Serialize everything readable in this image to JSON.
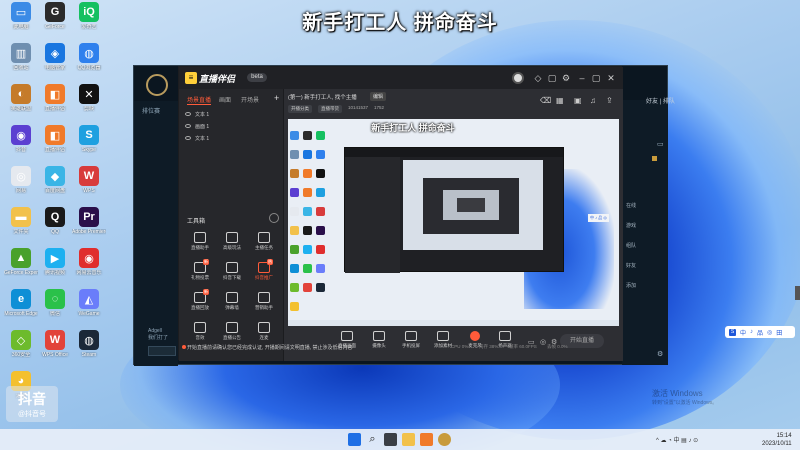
{
  "caption": "新手打工人 拼命奋斗",
  "desktop_icons": [
    {
      "label": "此电脑",
      "color": "#3b8be6",
      "glyph": "▭"
    },
    {
      "label": "GeForce",
      "color": "#2b2b2b",
      "glyph": "G"
    },
    {
      "label": "爱奇艺",
      "color": "#15c060",
      "glyph": "iQ"
    },
    {
      "label": "回收站",
      "color": "#6f8fb0",
      "glyph": "▥"
    },
    {
      "label": "电脑管家",
      "color": "#1976e0",
      "glyph": "◈"
    },
    {
      "label": "QQ浏览器",
      "color": "#2f80ed",
      "glyph": "◍"
    },
    {
      "label": "英雄联盟",
      "color": "#c57b2a",
      "glyph": "◐"
    },
    {
      "label": "直播伴侣",
      "color": "#f07a2a",
      "glyph": "◧"
    },
    {
      "label": "剪映",
      "color": "#111111",
      "glyph": "✕"
    },
    {
      "label": "抖音",
      "color": "#5b3fd1",
      "glyph": "◉"
    },
    {
      "label": "直播伴侣",
      "color": "#f07a2a",
      "glyph": "◧"
    },
    {
      "label": "Skype",
      "color": "#1ea0e0",
      "glyph": "S"
    },
    {
      "label": "网易",
      "color": "#e5e9ef",
      "glyph": "◎"
    },
    {
      "label": "百度网盘",
      "color": "#3ab5e6",
      "glyph": "◆"
    },
    {
      "label": "WPS",
      "color": "#d83b3b",
      "glyph": "W"
    },
    {
      "label": "文件夹",
      "color": "#f2c14b",
      "glyph": "▬"
    },
    {
      "label": "QQ",
      "color": "#1a1a1a",
      "glyph": "Q"
    },
    {
      "label": "Adobe Premiere",
      "color": "#2a0f4a",
      "glyph": "Pr"
    },
    {
      "label": "GeForce Experience",
      "color": "#49a12b",
      "glyph": "▲"
    },
    {
      "label": "腾讯视频",
      "color": "#1db0f0",
      "glyph": "▶"
    },
    {
      "label": "网易云音乐",
      "color": "#e02d2d",
      "glyph": "◉"
    },
    {
      "label": "Microsoft Edge",
      "color": "#0e8fd6",
      "glyph": "e"
    },
    {
      "label": "微信",
      "color": "#2ac14a",
      "glyph": "◌"
    },
    {
      "label": "WeGame",
      "color": "#6a7dfa",
      "glyph": "◭"
    },
    {
      "label": "360安全",
      "color": "#6dbb2c",
      "glyph": "◇"
    },
    {
      "label": "WPS Office",
      "color": "#e2433a",
      "glyph": "W"
    },
    {
      "label": "Steam",
      "color": "#1b2838",
      "glyph": "◍"
    },
    {
      "label": "迅雷",
      "color": "#f3c02e",
      "glyph": "◕"
    }
  ],
  "watermark": {
    "line1": "抖音",
    "line2": "@抖音号"
  },
  "back_app": {
    "title": "排位赛",
    "label1": "Adgell",
    "label2": "我们打了",
    "side_tab": "好友 | 排队",
    "right_items": [
      "在线",
      "游戏",
      "组队",
      "好友",
      "添加"
    ]
  },
  "main_app": {
    "brand": "直播伴侣",
    "version": "beta",
    "sidebar_tabs": [
      "场景直播",
      "画面",
      "开场景"
    ],
    "scenes": [
      "文本 1",
      "画面 1",
      "文本 1"
    ],
    "tools_title": "工具箱",
    "tools": [
      {
        "label": "直播助手",
        "hot": false
      },
      {
        "label": "高级玩法",
        "hot": false
      },
      {
        "label": "主播任务",
        "hot": false
      },
      {
        "label": "礼物投票",
        "hot": false,
        "badge": "新"
      },
      {
        "label": "抖音下载",
        "hot": false
      },
      {
        "label": "抖音推广",
        "hot": true,
        "badge": "热"
      },
      {
        "label": "直播回放",
        "hot": false,
        "badge": "新"
      },
      {
        "label": "弹幕墙",
        "hot": false
      },
      {
        "label": "营销助手",
        "hot": false
      },
      {
        "label": "音效",
        "hot": false
      },
      {
        "label": "直播公告",
        "hot": false
      },
      {
        "label": "连麦",
        "hot": false
      }
    ],
    "room_title": "(第一) 新手打工人, 找个主播",
    "room_edit": "编辑",
    "room_chips": [
      "开播分类",
      "直播带货",
      "10141537",
      "1752"
    ],
    "preview_caption": "新手打工人 拼命奋斗",
    "preview_chip": "中 ♪ 品 ◎",
    "bottom_tools": [
      "直播画面",
      "摄像头",
      "手机投屏",
      "添加素材",
      "麦克风",
      "扬声器"
    ],
    "start_button": "开始直播",
    "status_text": "开始直播前请确认您已经完成认证, 开播期间请文明直播, 禁止涉及低俗内容",
    "stats": [
      "CPU 0%",
      "内存 38%",
      "帧率 60.0FPS",
      "丢帧 0.0%"
    ]
  },
  "floatbar": {
    "items": [
      "中",
      "♪",
      "品",
      "◎",
      "田"
    ]
  },
  "win_activate": {
    "line1": "激活 Windows",
    "line2": "转到\"设置\"以激活 Windows。"
  },
  "taskbar": {
    "icons": [
      "windows-start",
      "search",
      "file-explorer",
      "folder",
      "livestream-companion",
      "league-client"
    ],
    "tray": "^ ☁ ◔ 中 ▤ ♪ ⊙",
    "time": "15:14",
    "date": "2023/10/11"
  }
}
